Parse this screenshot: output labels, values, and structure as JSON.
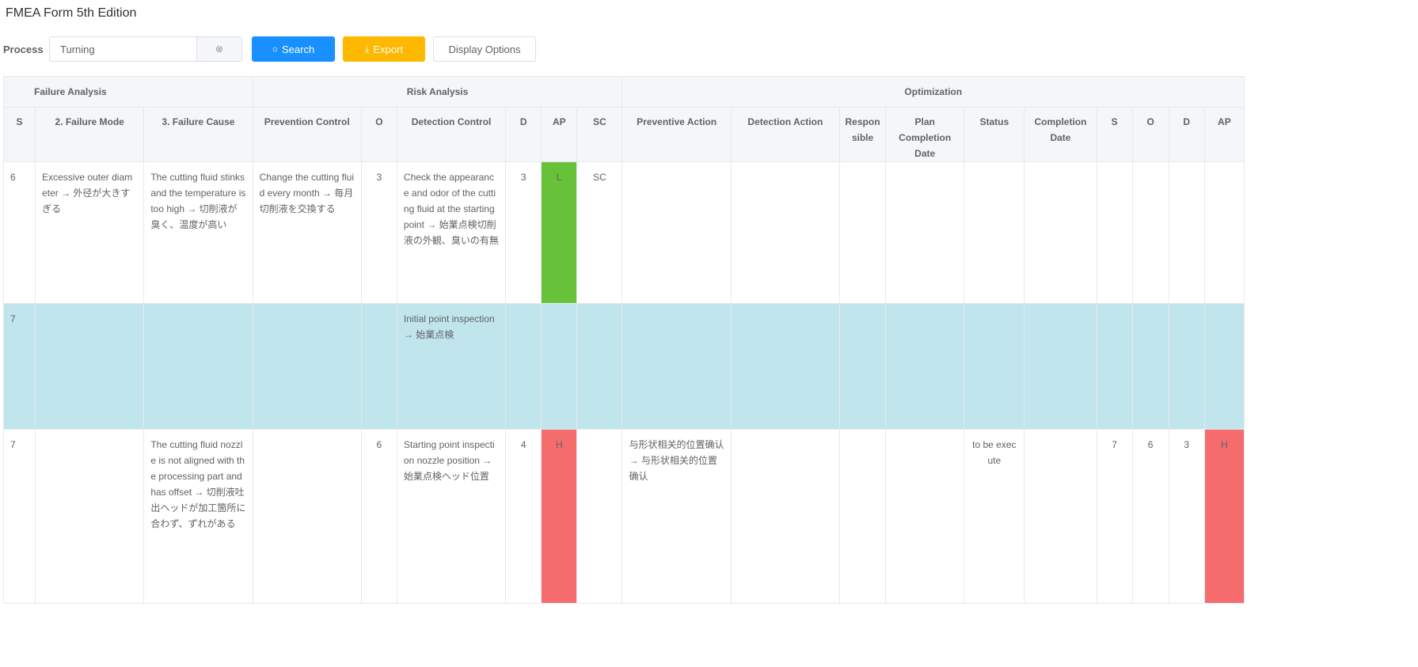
{
  "page": {
    "title": "FMEA Form 5th Edition"
  },
  "toolbar": {
    "process_label": "Process",
    "process_value": "Turning",
    "search_label": "Search",
    "export_label": "Export",
    "display_options_label": "Display Options"
  },
  "colors": {
    "primary": "#1890ff",
    "export": "#ffb800",
    "ap_low": "#67c23a",
    "ap_high": "#f56c6c",
    "row_highlight": "#c0e5ec",
    "header_bg": "#f4f6fa"
  },
  "table": {
    "groups": [
      "Failure Analysis",
      "Risk Analysis",
      "Optimization"
    ],
    "columns": [
      "S",
      "2. Failure Mode",
      "3. Failure Cause",
      "Prevention Control",
      "O",
      "Detection Control",
      "D",
      "AP",
      "SC",
      "Preventive Action",
      "Detection Action",
      "Responsible",
      "Plan Completion Date",
      "Status",
      "Completion Date",
      "S",
      "O",
      "D",
      "AP"
    ],
    "rows": [
      [
        "6",
        "Excessive outer diameter → 外径が大きすぎる",
        "The cutting fluid stinks and the temperature is too high → 切削液が臭く、温度が高い",
        "Change the cutting fluid every month → 毎月切削液を交換する",
        "3",
        "Check the appearance and odor of the cutting fluid at the starting point → 始業点検切削液の外観、臭いの有無",
        "3",
        "L",
        "SC",
        "",
        "",
        "",
        "",
        "",
        "",
        "",
        "",
        "",
        ""
      ],
      [
        "7",
        "",
        "",
        "",
        "",
        "Initial point inspection → 始業点検",
        "",
        "",
        "",
        "",
        "",
        "",
        "",
        "",
        "",
        "",
        "",
        "",
        ""
      ],
      [
        "7",
        "",
        "The cutting fluid nozzle is not aligned with the processing part and has offset → 切削液吐出ヘッドが加工箇所に合わず、ずれがある",
        "",
        "6",
        "Starting point inspection nozzle position → 始業点検ヘッド位置",
        "4",
        "H",
        "",
        "与形状相关的位置确认 → 与形状相关的位置确认",
        "",
        "",
        "",
        "to be execute",
        "",
        "7",
        "6",
        "3",
        "H"
      ]
    ]
  }
}
